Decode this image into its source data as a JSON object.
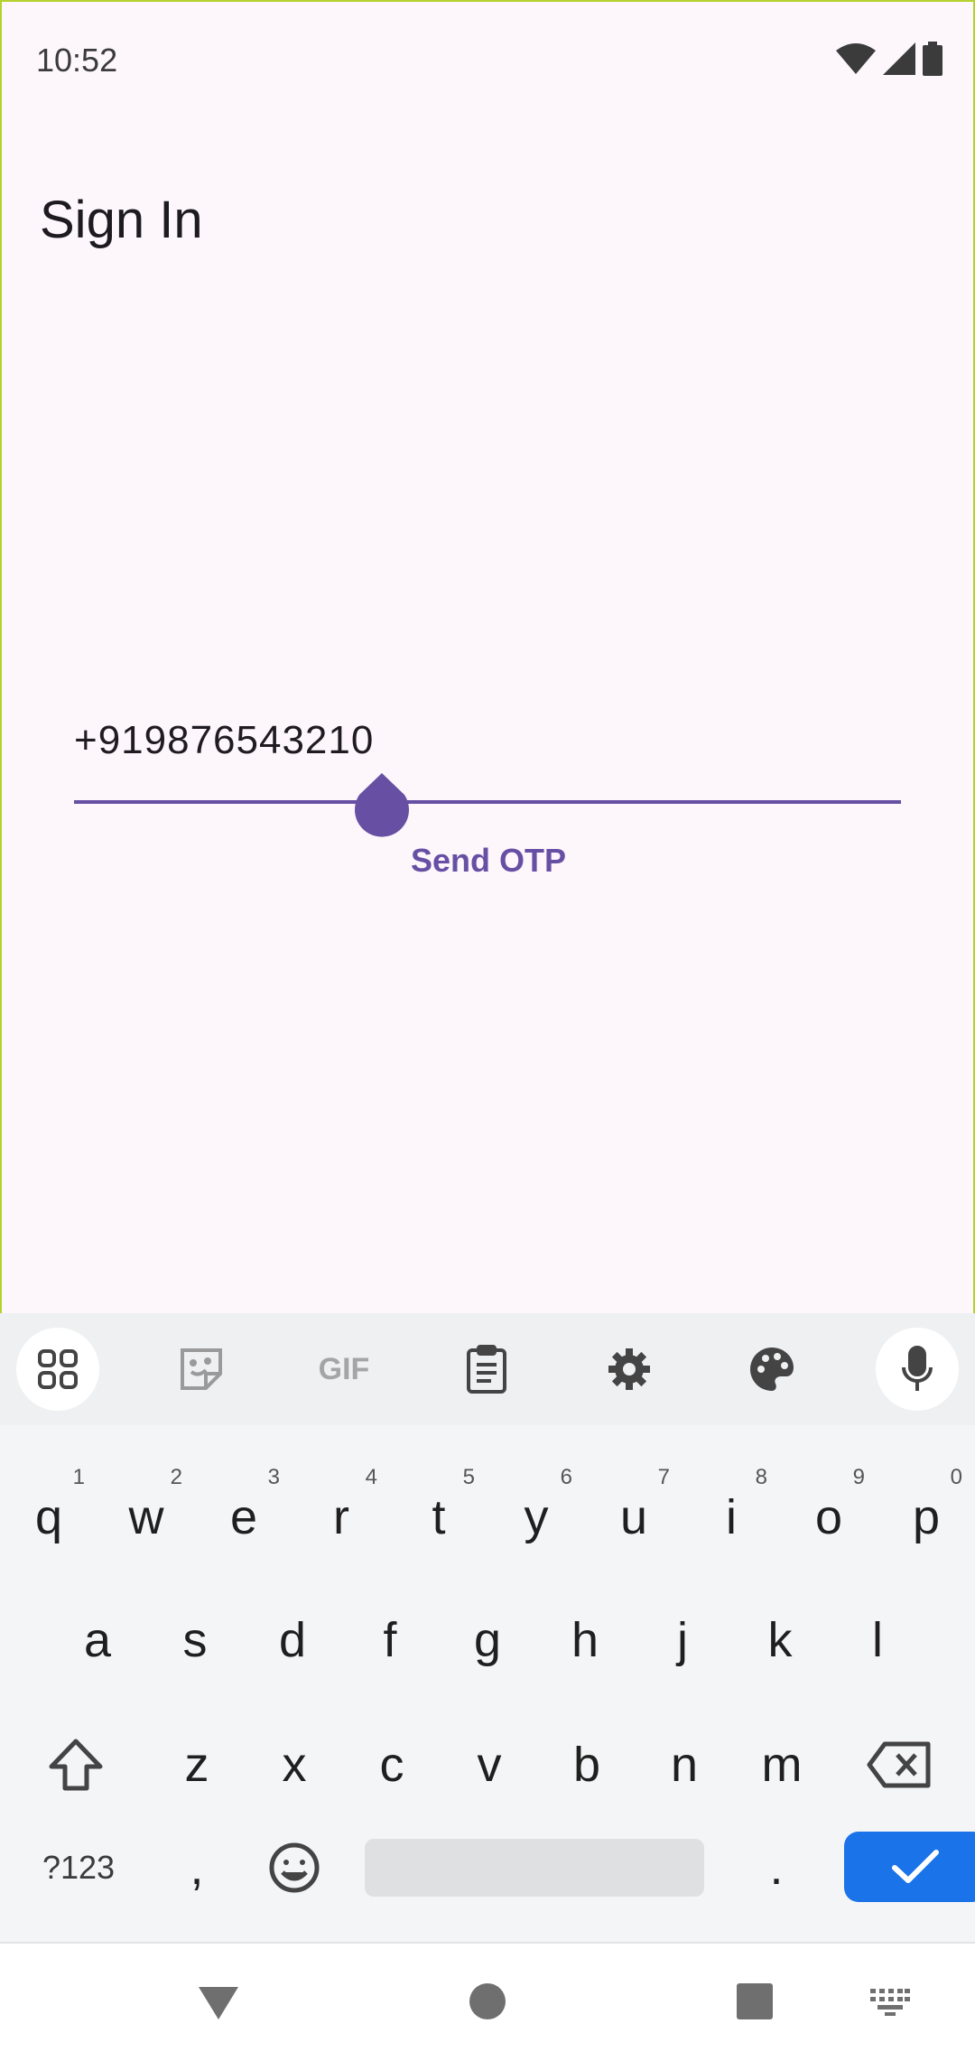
{
  "status_bar": {
    "time": "10:52"
  },
  "page": {
    "title": "Sign In"
  },
  "form": {
    "phone_value": "+919876543210",
    "send_label": "Send OTP"
  },
  "keyboard": {
    "toolbar": [
      "apps-grid-icon",
      "sticker-icon",
      "GIF",
      "clipboard-icon",
      "gear-icon",
      "palette-icon",
      "mic-icon"
    ],
    "gif_label": "GIF",
    "row1": [
      "q",
      "w",
      "e",
      "r",
      "t",
      "y",
      "u",
      "i",
      "o",
      "p"
    ],
    "row1_hints": [
      "1",
      "2",
      "3",
      "4",
      "5",
      "6",
      "7",
      "8",
      "9",
      "0"
    ],
    "row2": [
      "a",
      "s",
      "d",
      "f",
      "g",
      "h",
      "j",
      "k",
      "l"
    ],
    "row3": [
      "z",
      "x",
      "c",
      "v",
      "b",
      "n",
      "m"
    ],
    "symbols_label": "?123",
    "comma": ",",
    "period": ".",
    "accent_color": "#1a73e8"
  },
  "colors": {
    "primary": "#6750a4",
    "background": "#fdf7fc",
    "frame_border": "#b5d12b"
  }
}
